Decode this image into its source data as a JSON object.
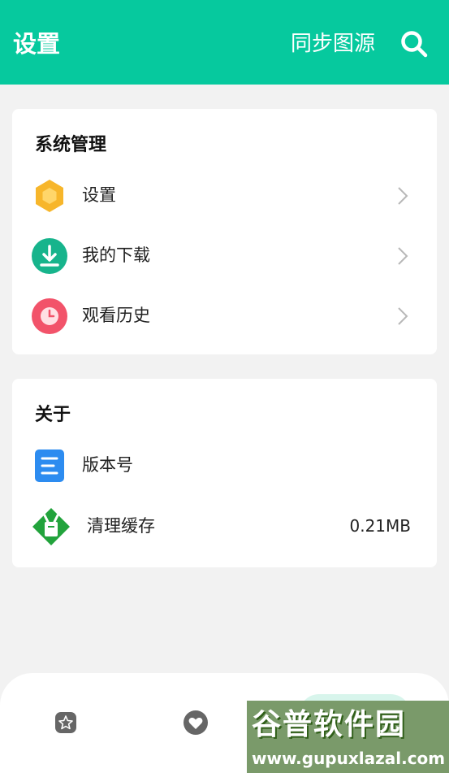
{
  "header": {
    "title": "设置",
    "sync_label": "同步图源",
    "search_icon": "search-icon",
    "background_color": "#06c99e"
  },
  "system_section": {
    "title": "系统管理",
    "items": [
      {
        "label": "设置",
        "icon": "hexagon-settings-icon",
        "icon_color": "#f7b62b"
      },
      {
        "label": "我的下载",
        "icon": "download-icon",
        "icon_color": "#17b48c"
      },
      {
        "label": "观看历史",
        "icon": "clock-icon",
        "icon_color": "#f2536a"
      }
    ]
  },
  "about_section": {
    "title": "关于",
    "items": [
      {
        "label": "版本号",
        "icon": "document-icon",
        "icon_color": "#2d8cf0"
      },
      {
        "label": "清理缓存",
        "icon": "broom-icon",
        "icon_color": "#22a33c",
        "value": "0.21MB"
      }
    ]
  },
  "bottom_nav": {
    "items": [
      {
        "icon": "star-icon"
      },
      {
        "icon": "heart-icon"
      },
      {
        "icon": "active-tab-pill"
      }
    ]
  },
  "watermark": {
    "logo_text": "谷普软件园",
    "url_text": "www.gupuxlazal.com"
  }
}
